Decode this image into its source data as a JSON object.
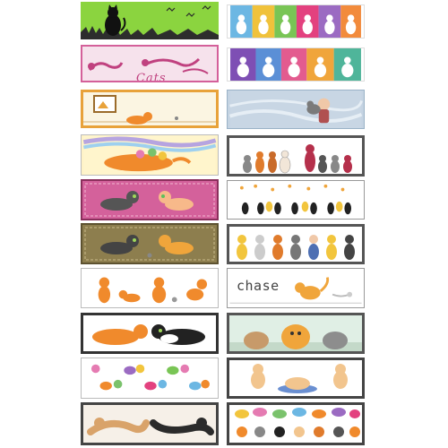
{
  "labels": {
    "cats_word": "Cats",
    "chase_word": "chase"
  },
  "palette": {
    "green": "#86d13c",
    "pink": "#d4609a",
    "gold": "#e8a23a",
    "olive": "#8a7b4b",
    "orange": "#f08a2c",
    "blue_grey": "#9ab2c7"
  },
  "cards": [
    {
      "name": "card-black-cat-grass-banner"
    },
    {
      "name": "card-colorful-cat-silhouettes-banner"
    },
    {
      "name": "card-pink-cats-banner"
    },
    {
      "name": "card-purple-cat-silhouettes-banner"
    },
    {
      "name": "card-framed-cat-banner"
    },
    {
      "name": "card-girl-holding-cat-banner"
    },
    {
      "name": "card-sleeping-cats-banner"
    },
    {
      "name": "card-sitting-cats-row-banner"
    },
    {
      "name": "card-pink-cats-meeting-banner"
    },
    {
      "name": "card-cats-and-butterflies-banner"
    },
    {
      "name": "card-olive-cats-banner"
    },
    {
      "name": "card-costumed-cats-banner"
    },
    {
      "name": "card-orange-cats-mouse-banner"
    },
    {
      "name": "card-chase-banner"
    },
    {
      "name": "card-cats-nose-to-nose-banner"
    },
    {
      "name": "card-three-cat-faces-banner"
    },
    {
      "name": "card-yarn-cats-pattern-banner"
    },
    {
      "name": "card-kittens-basket-banner"
    },
    {
      "name": "card-stretching-cats-banner"
    },
    {
      "name": "card-cats-speech-bubbles-banner"
    }
  ]
}
